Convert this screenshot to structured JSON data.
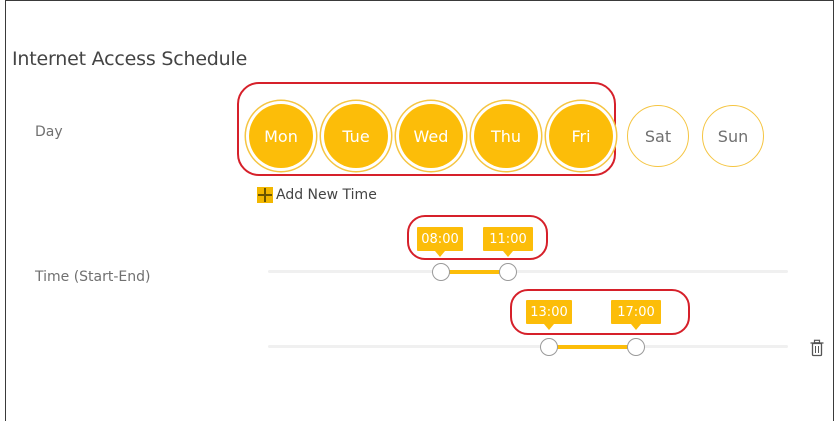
{
  "page": {
    "title": "Internet Access Schedule"
  },
  "day_section": {
    "label": "Day",
    "days": [
      {
        "name": "Mon",
        "selected": true
      },
      {
        "name": "Tue",
        "selected": true
      },
      {
        "name": "Wed",
        "selected": true
      },
      {
        "name": "Thu",
        "selected": true
      },
      {
        "name": "Fri",
        "selected": true
      },
      {
        "name": "Sat",
        "selected": false
      },
      {
        "name": "Sun",
        "selected": false
      }
    ]
  },
  "add_time": {
    "label": "Add New Time",
    "icon": "plus-icon"
  },
  "time_section": {
    "label": "Time (Start-End)",
    "ranges": [
      {
        "start": "08:00",
        "end": "11:00"
      },
      {
        "start": "13:00",
        "end": "17:00"
      }
    ],
    "delete_icon": "trash-icon"
  },
  "colors": {
    "accent": "#fcbd09",
    "highlight": "#d6202a"
  }
}
